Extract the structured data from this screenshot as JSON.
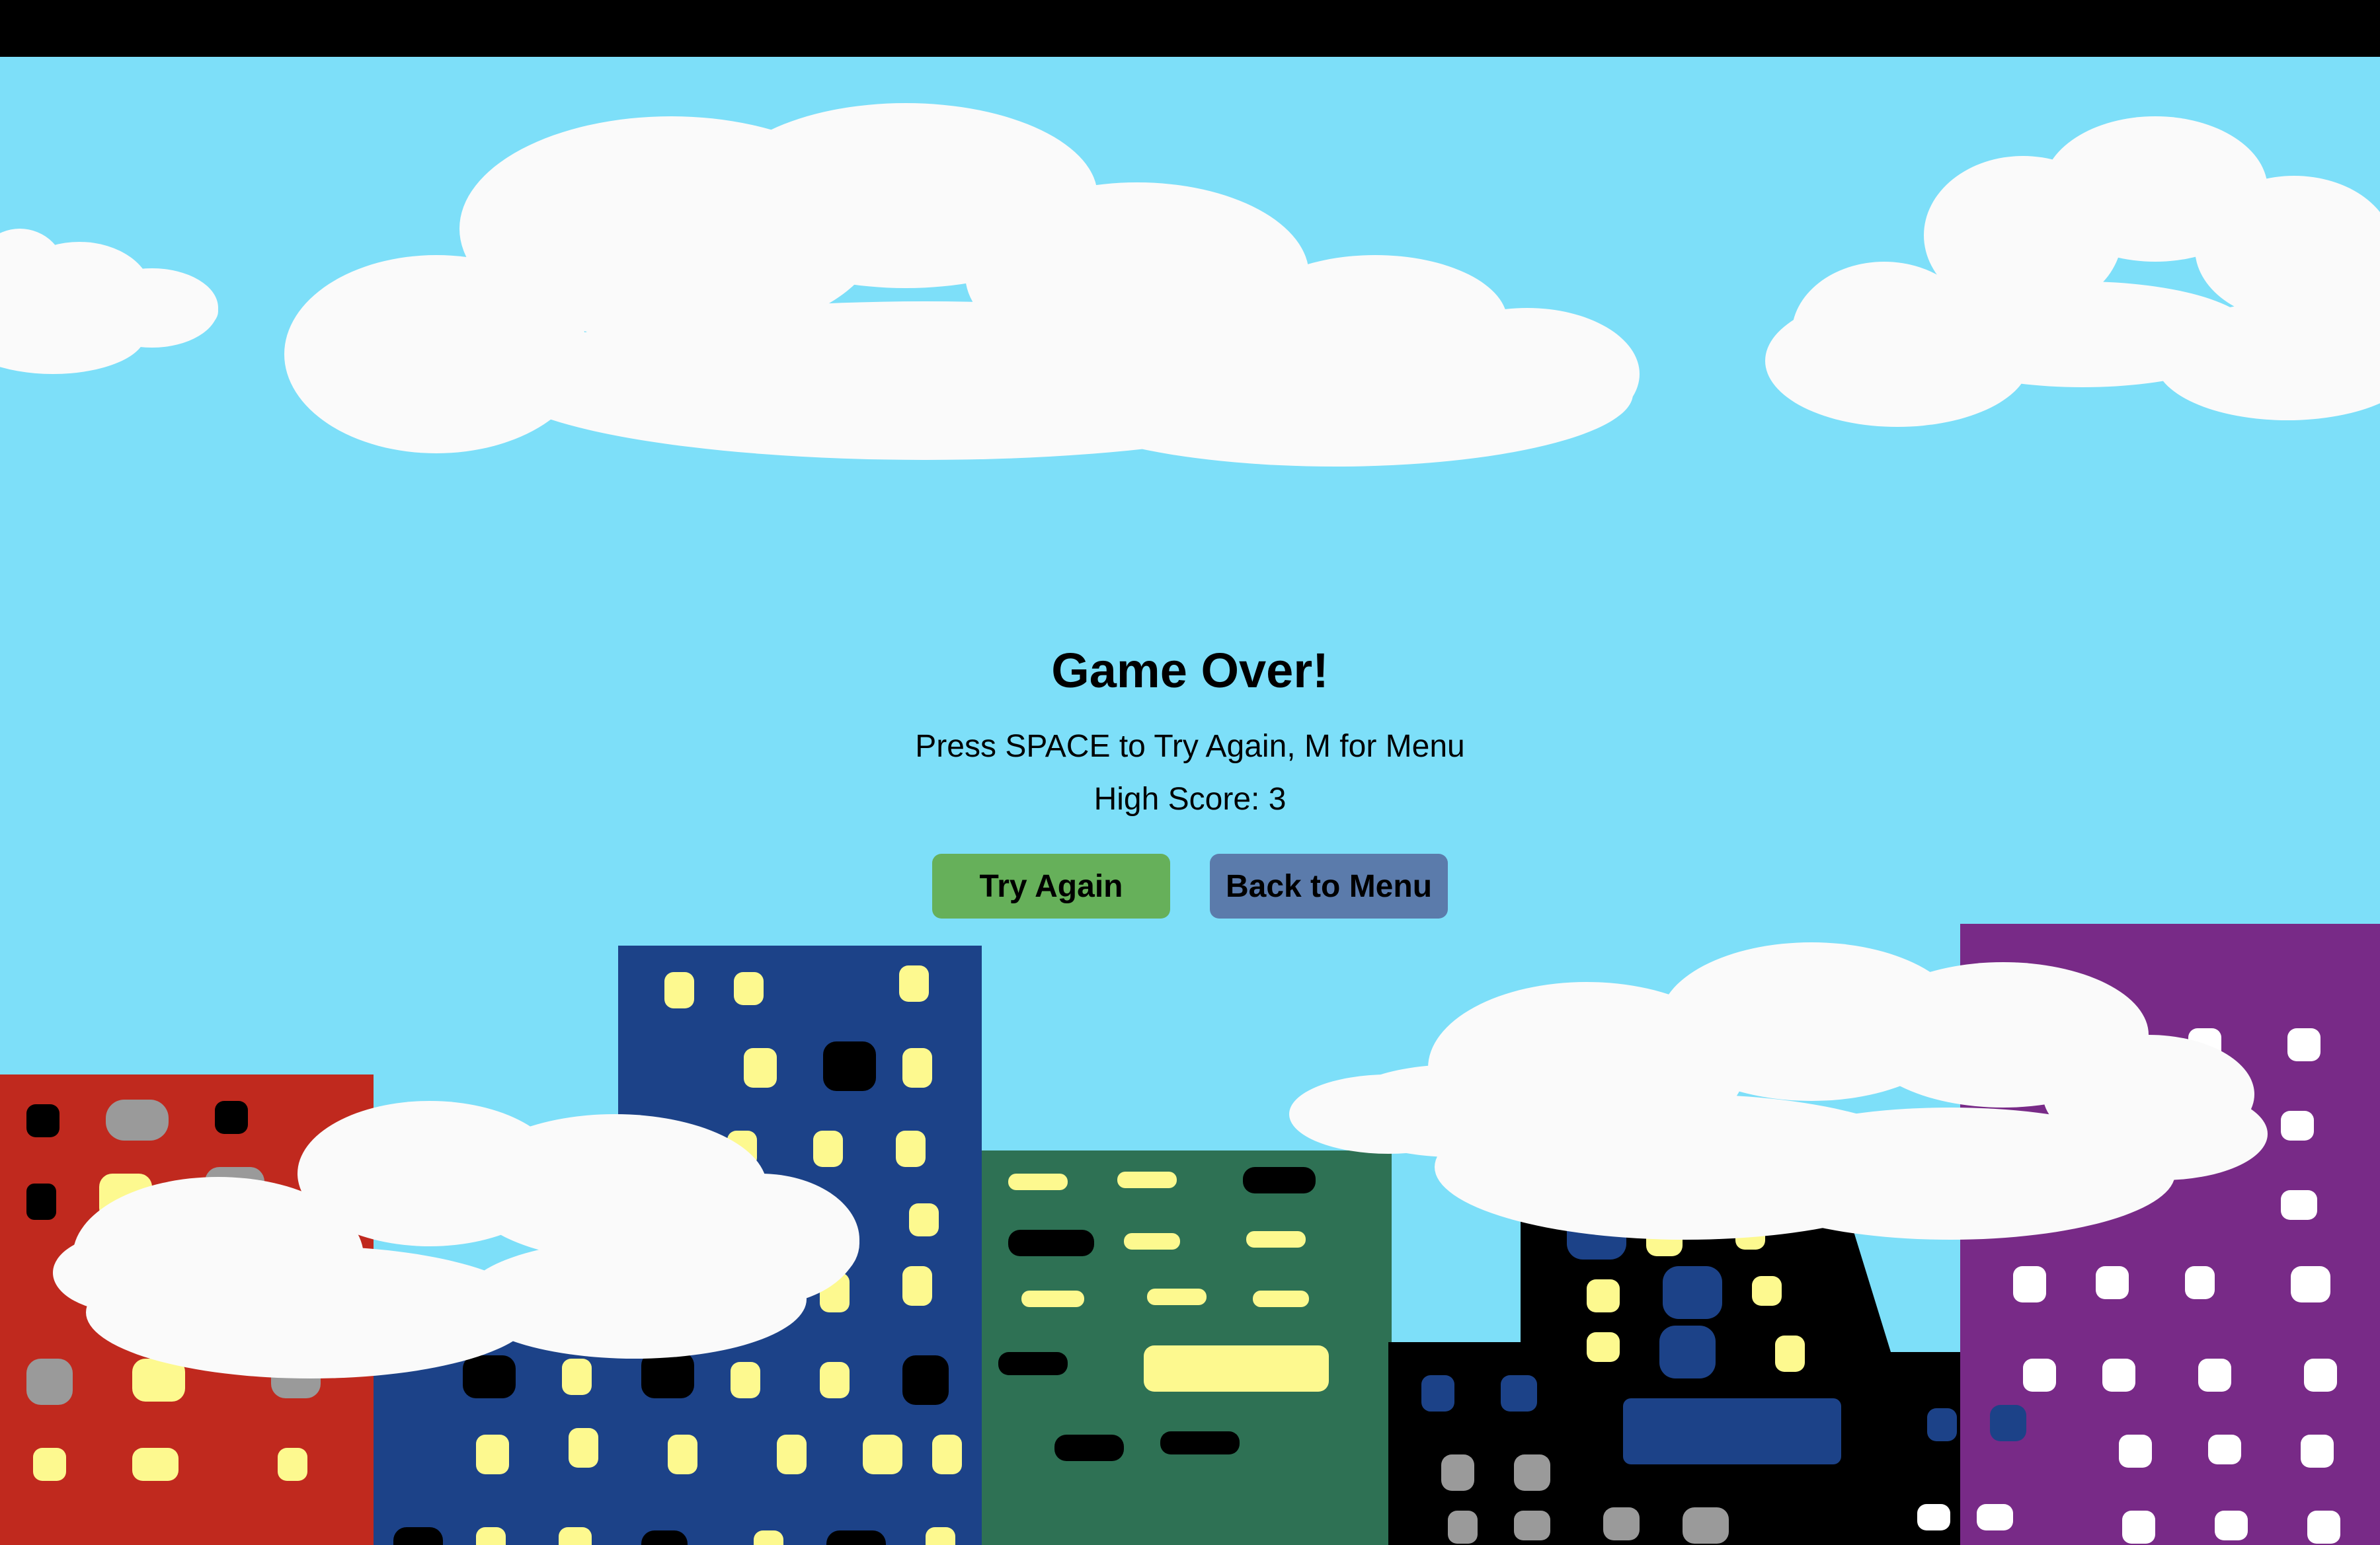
{
  "game": {
    "title": "Game Over!",
    "instructions": "Press SPACE to Try Again, M for Menu",
    "high_score_label": "High Score:",
    "high_score": 3
  },
  "buttons": {
    "try_again": {
      "label": "Try Again",
      "color": "#66b05a"
    },
    "back_to_menu": {
      "label": "Back to Menu",
      "color": "#5b7bab"
    }
  },
  "scene": {
    "sky_color": "#7ddff9",
    "cloud_color": "#fafafa",
    "building_colors": [
      "#c0291e",
      "#1c4288",
      "#2e7154",
      "#000000",
      "#782a87"
    ],
    "window_colors": [
      "#fdf98f",
      "#000000",
      "#9a9a9a",
      "#ffffff",
      "#1c4288"
    ]
  }
}
